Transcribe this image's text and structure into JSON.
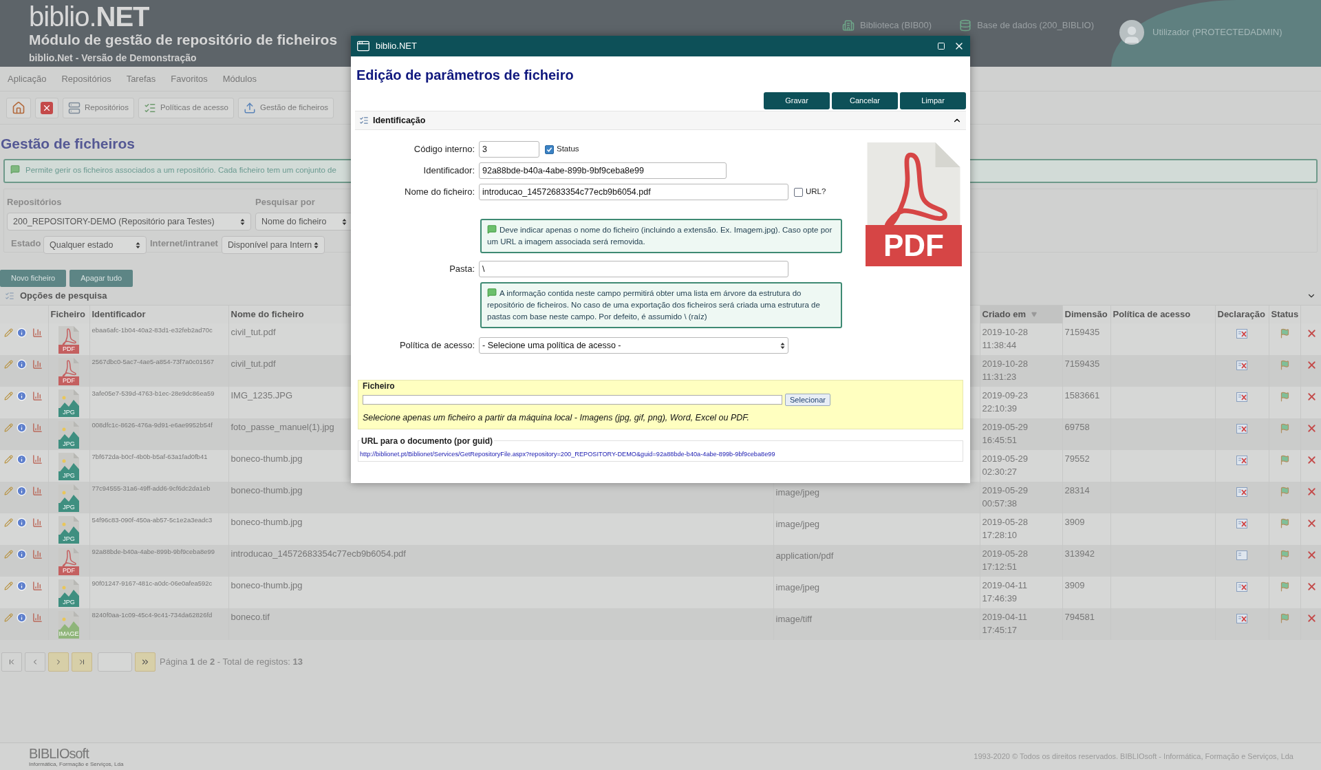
{
  "header": {
    "logo": "biblio.**NET**",
    "module_title": "Módulo de gestão de repositório de ficheiros",
    "subtitle": "biblio.Net - Versão de Demonstração",
    "library": "Biblioteca (BIB00)",
    "database": "Base de dados (200_BIBLIO)",
    "user": "Utilizador (PROTECTEDADMIN)"
  },
  "menu": [
    "Aplicação",
    "Repositórios",
    "Tarefas",
    "Favoritos",
    "Módulos"
  ],
  "toolbar": [
    {
      "kind": "home"
    },
    {
      "kind": "close"
    },
    {
      "kind": "repositories",
      "label": "Repositórios"
    },
    {
      "kind": "policies",
      "label": "Políticas de acesso"
    },
    {
      "kind": "upload",
      "label": "Gestão de ficheiros"
    }
  ],
  "page_title": "Gestão de ficheiros",
  "info": "Permite gerir os ficheiros associados a um repositório. Cada ficheiro tem um conjunto de",
  "filters": {
    "repositories_label": "Repositórios",
    "repository": "200_REPOSITORY-DEMO (Repositório para Testes)",
    "search_by_label": "Pesquisar por",
    "search_by": "Nome do ficheiro",
    "state_label": "Estado",
    "state": "Qualquer estado",
    "access_label": "Internet/intranet",
    "access": "Disponível para Intern"
  },
  "actions": [
    "Novo ficheiro",
    "Apagar tudo"
  ],
  "search_options": {
    "title": "Opções de pesquisa",
    "expanded": false
  },
  "table": {
    "columns": [
      {
        "label": "Ficheiro",
        "sorted": false
      },
      {
        "label": "Identificador",
        "sorted": false
      },
      {
        "label": "Nome do ficheiro",
        "sorted": false
      },
      {
        "label": "Criado em",
        "sorted": true
      },
      {
        "label": "Dimensão",
        "sorted": false
      },
      {
        "label": "Política de acesso",
        "sorted": false
      },
      {
        "label": "Declaração",
        "sorted": false
      },
      {
        "label": "Status",
        "sorted": false
      }
    ],
    "rows": [
      {
        "kind": "pdf",
        "badge": "PDF",
        "id": "ebaa6afc-1b04-40a2-83d1-e32feb2ad70c",
        "name": "civil_tut.pdf",
        "created": "2019-10-28 11:38:44",
        "size": "7159435",
        "declaration": false
      },
      {
        "kind": "pdf",
        "badge": "PDF",
        "id": "2567dbc0-5ac7-4ae5-a854-73f7a0c01567",
        "name": "civil_tut.pdf",
        "created": "2019-10-28 11:31:23",
        "size": "7159435",
        "declaration": false
      },
      {
        "kind": "jpg",
        "badge": "JPG",
        "id": "3afe05e7-539d-4763-b1ec-28e9dc86ea59",
        "name": "IMG_1235.JPG",
        "created": "2019-09-23 22:10:39",
        "size": "1583661",
        "declaration": false
      },
      {
        "kind": "jpg",
        "badge": "JPG",
        "id": "008dfc1c-8626-476a-9d91-e6ae9952b54f",
        "name": "foto_passe_manuel(1).jpg",
        "created": "2019-05-29 16:45:51",
        "size": "69758",
        "declaration": false
      },
      {
        "kind": "jpg",
        "badge": "JPG",
        "id": "7bf672da-b0cf-4b0b-b5af-63a1fad0fb41",
        "name": "boneco-thumb.jpg",
        "created": "2019-05-29 02:30:27",
        "size": "79552",
        "declaration": false
      },
      {
        "kind": "jpg",
        "badge": "JPG",
        "id": "77c94555-31a6-49ff-add6-9cf6dc2da1eb",
        "name": "boneco-thumb.jpg",
        "mime": "image/jpeg",
        "created": "2019-05-29 00:57:38",
        "size": "28314",
        "declaration": false
      },
      {
        "kind": "jpg",
        "badge": "JPG",
        "id": "54f96c83-090f-450a-ab57-5c1e2a3eadc3",
        "name": "boneco-thumb.jpg",
        "mime": "image/jpeg",
        "created": "2019-05-28 17:28:10",
        "size": "3909",
        "declaration": false
      },
      {
        "kind": "pdf",
        "badge": "PDF",
        "id": "92a88bde-b40a-4abe-899b-9bf9ceba8e99",
        "name": "introducao_14572683354c77ecb9b6054.pdf",
        "mime": "application/pdf",
        "created": "2019-05-28 17:12:51",
        "size": "313942",
        "declaration": true
      },
      {
        "kind": "jpg",
        "badge": "JPG",
        "id": "90f01247-9167-481c-a0dc-06e0afea592c",
        "name": "boneco-thumb.jpg",
        "mime": "image/jpeg",
        "created": "2019-04-11 17:46:39",
        "size": "3909",
        "declaration": false
      },
      {
        "kind": "image",
        "badge": "IMAGE",
        "id": "8240f0aa-1c09-45c4-9c41-734da62826fd",
        "name": "boneco.tif",
        "mime": "image/tiff",
        "created": "2019-04-11 17:45:17",
        "size": "794581",
        "declaration": false
      }
    ]
  },
  "pagination": {
    "text": "Página **1** de **2** - Total de registos: **13**"
  },
  "footer": {
    "logo": "BIBLIOsoft",
    "tagline": "Informática, Formação e Serviços, Lda",
    "copyright": "1993-2020 © Todos os direitos reservados. BIBLIOsoft - Informática, Formação e Serviços, Lda"
  },
  "dialog": {
    "window_title": "biblio.NET",
    "heading": "Edição de parâmetros de ficheiro",
    "buttons": [
      "Gravar",
      "Cancelar",
      "Limpar"
    ],
    "section": {
      "title": "Identificação",
      "expanded": true
    },
    "code": {
      "label": "Código interno:",
      "value": "3"
    },
    "status": {
      "label": "Status",
      "checked": true
    },
    "identifier": {
      "label": "Identificador:",
      "value": "92a88bde-b40a-4abe-899b-9bf9ceba8e99"
    },
    "filename": {
      "label": "Nome do ficheiro:",
      "value": "introducao_14572683354c77ecb9b6054.pdf"
    },
    "url_checkbox": {
      "label": "URL?",
      "checked": false
    },
    "hint_filename": "Deve indicar apenas o nome do ficheiro (incluindo a extensão. Ex. Imagem.jpg). Caso opte por um URL a imagem associada será removida.",
    "folder": {
      "label": "Pasta:",
      "value": "\\"
    },
    "hint_folder": "A informação contida neste campo permitirá obter uma lista em árvore da estrutura do repositório de ficheiros. No caso de uma exportação dos ficheiros será criada uma estrutura de pastas com base neste campo. Por defeito, é assumido \\ (raíz)",
    "policy": {
      "label": "Política de acesso:",
      "value": "- Selecione uma política de acesso -"
    },
    "preview_badge": "PDF",
    "file": {
      "legend": "Ficheiro",
      "button": "Selecionar",
      "note": "Selecione apenas um ficheiro a partir da máquina local - Imagens (jpg, gif, png), Word, Excel ou PDF."
    },
    "url": {
      "legend": "URL para o documento (por guid)",
      "link": "http://biblionet.pt/Biblionet/Services/GetRepositoryFile.aspx?repository=200_REPOSITORY-DEMO&guid=92a88bde-b40a-4abe-899b-9bf9ceba8e99"
    }
  }
}
